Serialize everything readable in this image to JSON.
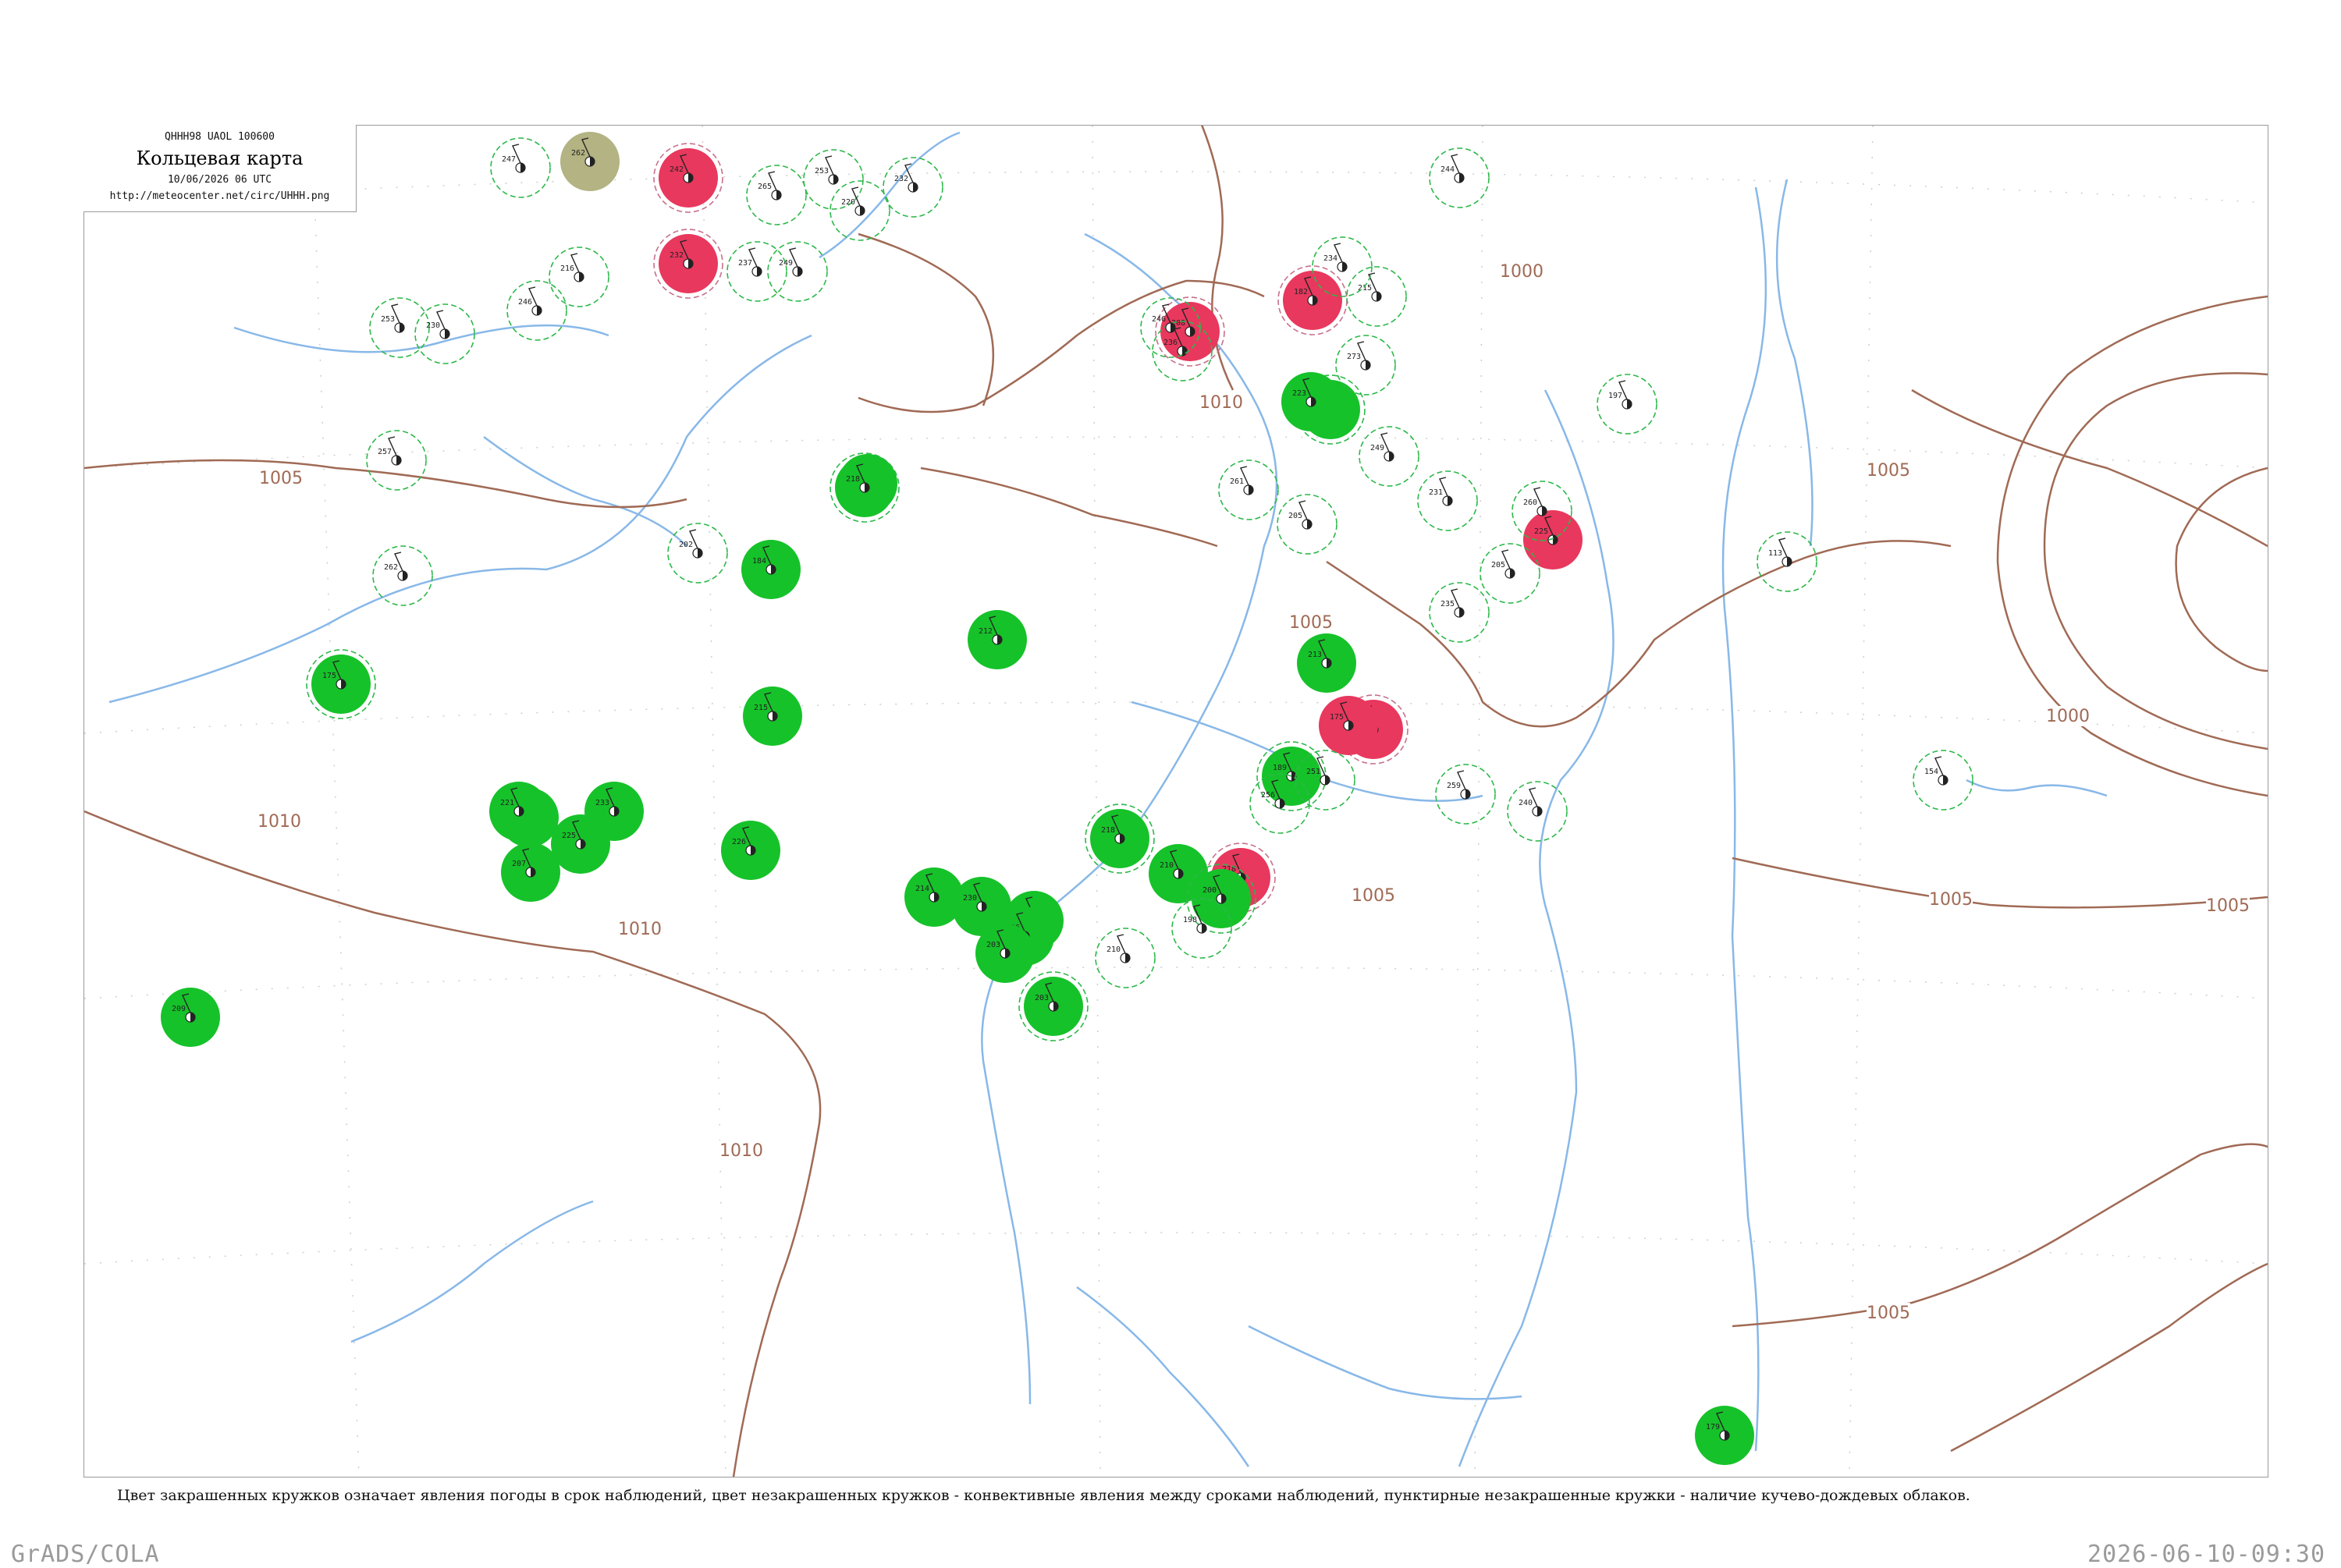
{
  "header": {
    "code": "QHHH98  UAOL  100600",
    "title": "Кольцевая карта",
    "date": "10/06/2026 06 UTC",
    "url": "http://meteocenter.net/circ/UHHH.png"
  },
  "caption": "Цвет закрашенных кружков означает явления погоды в срок наблюдений, цвет незакрашенных кружков - конвективные явления между сроками наблюдений, пунктирные незакрашенные кружки - наличие кучево-дождевых облаков.",
  "footer": {
    "left": "GrADS/COLA",
    "right": "2026-06-10-09:30"
  },
  "colors": {
    "rain": "#16c22a",
    "thunderstorm": "#e8385e",
    "haze": "#b3b383",
    "cb_ring": "#2db84a",
    "isobar": "#a06a55",
    "river": "#88b8e8",
    "frame": "#9a9a9a"
  },
  "isobars": [
    {
      "label": "1010",
      "value": 1010
    },
    {
      "label": "1005",
      "value": 1005
    },
    {
      "label": "1010",
      "value": 1010
    },
    {
      "label": "1005",
      "value": 1005
    },
    {
      "label": "1005",
      "value": 1005
    },
    {
      "label": "1005",
      "value": 1005
    },
    {
      "label": "1000",
      "value": 1000
    },
    {
      "label": "1005",
      "value": 1005
    },
    {
      "label": "1005",
      "value": 1005
    },
    {
      "label": "1010",
      "value": 1010
    },
    {
      "label": "1010",
      "value": 1010
    },
    {
      "label": "1000",
      "value": 1000
    },
    {
      "label": "1010",
      "value": 1010
    },
    {
      "label": "1005",
      "value": 1005
    }
  ],
  "stations": [
    {
      "phenomenon": "thunderstorm",
      "cb": true,
      "text": "242"
    },
    {
      "phenomenon": "thunderstorm",
      "cb": true,
      "text": "232"
    },
    {
      "phenomenon": "thunderstorm",
      "cb": true,
      "text": "208"
    },
    {
      "phenomenon": "thunderstorm",
      "cb": true,
      "text": "182"
    },
    {
      "phenomenon": "thunderstorm",
      "cb": false,
      "text": "225"
    },
    {
      "phenomenon": "thunderstorm",
      "cb": true,
      "text": "197"
    },
    {
      "phenomenon": "thunderstorm",
      "cb": true,
      "text": "218"
    },
    {
      "phenomenon": "thunderstorm",
      "cb": false,
      "text": "175"
    },
    {
      "phenomenon": "rain",
      "cb": false,
      "text": "165"
    },
    {
      "phenomenon": "rain",
      "cb": false,
      "text": "184"
    },
    {
      "phenomenon": "rain",
      "cb": true,
      "text": "175"
    },
    {
      "phenomenon": "rain",
      "cb": false,
      "text": "231"
    },
    {
      "phenomenon": "rain",
      "cb": false,
      "text": "225"
    },
    {
      "phenomenon": "rain",
      "cb": false,
      "text": "207"
    },
    {
      "phenomenon": "rain",
      "cb": false,
      "text": "221"
    },
    {
      "phenomenon": "rain",
      "cb": false,
      "text": "233"
    },
    {
      "phenomenon": "rain",
      "cb": false,
      "text": "226"
    },
    {
      "phenomenon": "rain",
      "cb": false,
      "text": "215"
    },
    {
      "phenomenon": "rain",
      "cb": false,
      "text": "212"
    },
    {
      "phenomenon": "rain",
      "cb": false,
      "text": "214"
    },
    {
      "phenomenon": "rain",
      "cb": false,
      "text": "230"
    },
    {
      "phenomenon": "rain",
      "cb": false,
      "text": "220"
    },
    {
      "phenomenon": "rain",
      "cb": false,
      "text": "196"
    },
    {
      "phenomenon": "rain",
      "cb": true,
      "text": "203"
    },
    {
      "phenomenon": "rain",
      "cb": false,
      "text": "203"
    },
    {
      "phenomenon": "rain",
      "cb": true,
      "text": "218"
    },
    {
      "phenomenon": "rain",
      "cb": false,
      "text": "210"
    },
    {
      "phenomenon": "rain",
      "cb": true,
      "text": "200"
    },
    {
      "phenomenon": "rain",
      "cb": true,
      "text": "189"
    },
    {
      "phenomenon": "rain",
      "cb": false,
      "text": "213"
    },
    {
      "phenomenon": "rain",
      "cb": true,
      "text": "196"
    },
    {
      "phenomenon": "rain",
      "cb": false,
      "text": "223"
    },
    {
      "phenomenon": "rain",
      "cb": true,
      "text": "218"
    },
    {
      "phenomenon": "rain",
      "cb": false,
      "text": "179"
    },
    {
      "phenomenon": "rain",
      "cb": false,
      "text": "209"
    },
    {
      "phenomenon": "haze",
      "cb": false,
      "text": "262"
    },
    {
      "phenomenon": "none",
      "cb": true,
      "text": "247"
    },
    {
      "phenomenon": "none",
      "cb": true,
      "text": "253"
    },
    {
      "phenomenon": "none",
      "cb": true,
      "text": "257"
    },
    {
      "phenomenon": "none",
      "cb": true,
      "text": "220"
    },
    {
      "phenomenon": "none",
      "cb": true,
      "text": "237"
    },
    {
      "phenomenon": "none",
      "cb": true,
      "text": "249"
    },
    {
      "phenomenon": "none",
      "cb": true,
      "text": "265"
    },
    {
      "phenomenon": "none",
      "cb": true,
      "text": "262"
    },
    {
      "phenomenon": "none",
      "cb": true,
      "text": "202"
    },
    {
      "phenomenon": "none",
      "cb": true,
      "text": "232"
    },
    {
      "phenomenon": "none",
      "cb": true,
      "text": "198"
    },
    {
      "phenomenon": "none",
      "cb": true,
      "text": "210"
    },
    {
      "phenomenon": "none",
      "cb": true,
      "text": "256"
    },
    {
      "phenomenon": "none",
      "cb": true,
      "text": "251"
    },
    {
      "phenomenon": "none",
      "cb": true,
      "text": "235"
    },
    {
      "phenomenon": "none",
      "cb": true,
      "text": "259"
    },
    {
      "phenomenon": "none",
      "cb": true,
      "text": "240"
    },
    {
      "phenomenon": "none",
      "cb": true,
      "text": "231"
    },
    {
      "phenomenon": "none",
      "cb": true,
      "text": "260"
    },
    {
      "phenomenon": "none",
      "cb": true,
      "text": "205"
    },
    {
      "phenomenon": "none",
      "cb": true,
      "text": "113"
    },
    {
      "phenomenon": "none",
      "cb": true,
      "text": "154"
    },
    {
      "phenomenon": "none",
      "cb": true,
      "text": "244"
    },
    {
      "phenomenon": "none",
      "cb": true,
      "text": "215"
    },
    {
      "phenomenon": "none",
      "cb": true,
      "text": "249"
    },
    {
      "phenomenon": "none",
      "cb": true,
      "text": "261"
    },
    {
      "phenomenon": "none",
      "cb": true,
      "text": "273"
    },
    {
      "phenomenon": "none",
      "cb": true,
      "text": "234"
    },
    {
      "phenomenon": "none",
      "cb": true,
      "text": "236"
    },
    {
      "phenomenon": "none",
      "cb": true,
      "text": "246"
    },
    {
      "phenomenon": "none",
      "cb": true,
      "text": "216"
    },
    {
      "phenomenon": "none",
      "cb": true,
      "text": "246"
    },
    {
      "phenomenon": "none",
      "cb": true,
      "text": "253"
    },
    {
      "phenomenon": "none",
      "cb": true,
      "text": "230"
    },
    {
      "phenomenon": "none",
      "cb": true,
      "text": "197"
    },
    {
      "phenomenon": "none",
      "cb": true,
      "text": "205"
    }
  ]
}
